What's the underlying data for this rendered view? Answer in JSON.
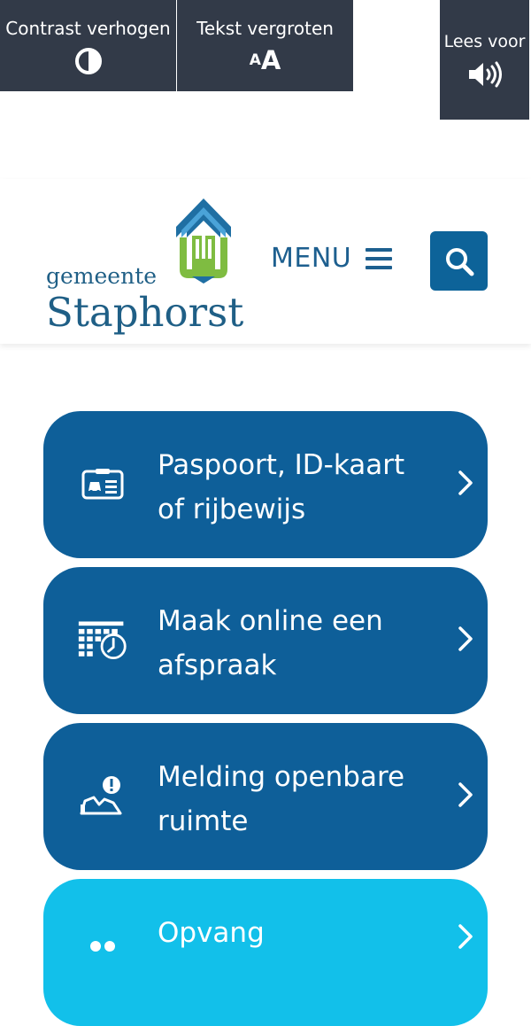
{
  "accessibility": {
    "contrast_label": "Contrast verhogen",
    "text_label": "Tekst vergroten",
    "text_icon_small": "A",
    "text_icon_big": "A",
    "read_label": "Lees voor",
    "contrast_icon": "contrast-icon",
    "read_icon": "speaker-icon"
  },
  "header": {
    "logo_line1": "gemeente",
    "logo_line2": "Staphorst",
    "menu_label": "MENU",
    "menu_icon": "hamburger-icon",
    "search_icon": "search-icon"
  },
  "tiles": [
    {
      "label": "Paspoort, ID-kaart of rijbewijs",
      "icon": "id-card-icon"
    },
    {
      "label": "Maak online een afspraak",
      "icon": "calendar-clock-icon"
    },
    {
      "label": "Melding openbare ruimte",
      "icon": "report-issue-icon"
    },
    {
      "label": "Opvang",
      "icon": "people-icon"
    }
  ],
  "colors": {
    "topbar": "#323a48",
    "brand_blue": "#0e5f99",
    "light_blue": "#12c0ea",
    "logo_green": "#7fbc41",
    "text_blue": "#1f5f86"
  }
}
